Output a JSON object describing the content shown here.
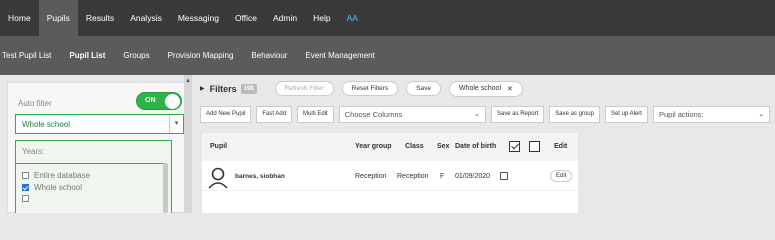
{
  "topnav": {
    "items": [
      "Home",
      "Pupils",
      "Results",
      "Analysis",
      "Messaging",
      "Office",
      "Admin",
      "Help",
      "AA"
    ],
    "active_index": 1
  },
  "subnav": {
    "items": [
      "Test Pupil List",
      "Pupil List",
      "Groups",
      "Provision Mapping",
      "Behaviour",
      "Event Management"
    ],
    "active_index": 1
  },
  "left": {
    "autofilter_label": "Auto filter",
    "toggle_label": "ON",
    "scope_value": "Whole school",
    "years_label": "Years:",
    "options": [
      {
        "label": "Entire database",
        "checked": false
      },
      {
        "label": "Whole school",
        "checked": true
      }
    ]
  },
  "filters": {
    "title": "Filters",
    "count_badge": "198",
    "refresh_label": "Refresh Filter",
    "reset_label": "Reset Filters",
    "save_label": "Save",
    "active_tag": "Whole school",
    "tag_remove": "✕"
  },
  "toolbar": {
    "add_new_pupil": "Add New Pupil",
    "fast_add": "Fast Add",
    "multi_edit": "Multi Edit",
    "choose_columns": "Choose Columns",
    "save_as_report": "Save as Report",
    "save_as_group": "Save as group",
    "set_up_alert": "Set up Alert",
    "pupil_actions": "Pupil actions:"
  },
  "table": {
    "headers": {
      "pupil": "Pupil",
      "year_group": "Year group",
      "class": "Class",
      "sex": "Sex",
      "dob": "Date of birth",
      "edit": "Edit"
    },
    "rows": [
      {
        "name": "barnes, siobhan",
        "year_group": "Reception",
        "class": "Reception",
        "sex": "F",
        "dob": "01/09/2020",
        "edit": "Edit"
      }
    ]
  }
}
